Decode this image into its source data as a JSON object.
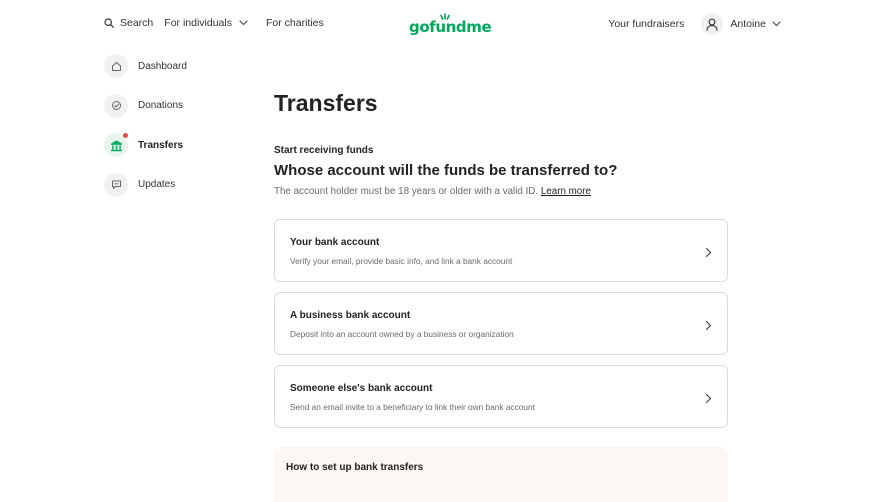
{
  "header": {
    "search_label": "Search",
    "for_individuals_label": "For individuals",
    "for_charities_label": "For charities",
    "logo_text": "gofundme",
    "your_fundraisers_label": "Your fundraisers",
    "user_name": "Antoine",
    "brand_color": "#02a95c"
  },
  "sidebar": {
    "items": [
      {
        "label": "Dashboard",
        "icon": "home-icon",
        "active": false
      },
      {
        "label": "Donations",
        "icon": "donations-icon",
        "active": false
      },
      {
        "label": "Transfers",
        "icon": "bank-icon",
        "active": true,
        "notification_dot": true
      },
      {
        "label": "Updates",
        "icon": "updates-icon",
        "active": false
      }
    ]
  },
  "main": {
    "title": "Transfers",
    "subhead": "Start receiving funds",
    "question": "Whose account will the funds be transferred to?",
    "helper_text": "The account holder must be 18 years or older with a valid ID.",
    "learn_more": "Learn more",
    "options": [
      {
        "title": "Your bank account",
        "description": "Verify your email, provide basic info, and link a bank account"
      },
      {
        "title": "A business bank account",
        "description": "Deposit into an account owned by a business or organization"
      },
      {
        "title": "Someone else's bank account",
        "description": "Send an email invite to a beneficiary to link their own bank account"
      }
    ],
    "howto_title": "How to set up bank transfers"
  }
}
